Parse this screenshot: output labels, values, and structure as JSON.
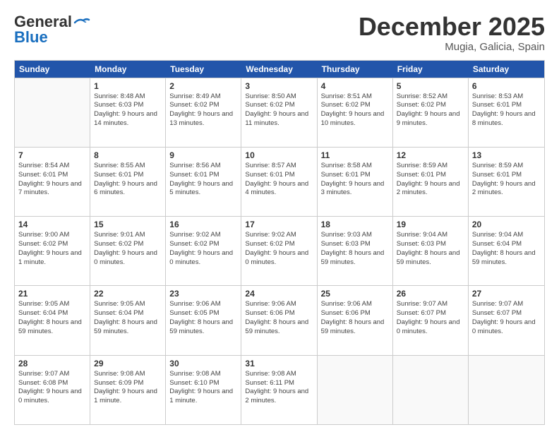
{
  "header": {
    "logo_general": "General",
    "logo_blue": "Blue",
    "month": "December 2025",
    "location": "Mugia, Galicia, Spain"
  },
  "days": [
    "Sunday",
    "Monday",
    "Tuesday",
    "Wednesday",
    "Thursday",
    "Friday",
    "Saturday"
  ],
  "weeks": [
    [
      {
        "date": "",
        "sunrise": "",
        "sunset": "",
        "daylight": ""
      },
      {
        "date": "1",
        "sunrise": "Sunrise: 8:48 AM",
        "sunset": "Sunset: 6:03 PM",
        "daylight": "Daylight: 9 hours and 14 minutes."
      },
      {
        "date": "2",
        "sunrise": "Sunrise: 8:49 AM",
        "sunset": "Sunset: 6:02 PM",
        "daylight": "Daylight: 9 hours and 13 minutes."
      },
      {
        "date": "3",
        "sunrise": "Sunrise: 8:50 AM",
        "sunset": "Sunset: 6:02 PM",
        "daylight": "Daylight: 9 hours and 11 minutes."
      },
      {
        "date": "4",
        "sunrise": "Sunrise: 8:51 AM",
        "sunset": "Sunset: 6:02 PM",
        "daylight": "Daylight: 9 hours and 10 minutes."
      },
      {
        "date": "5",
        "sunrise": "Sunrise: 8:52 AM",
        "sunset": "Sunset: 6:02 PM",
        "daylight": "Daylight: 9 hours and 9 minutes."
      },
      {
        "date": "6",
        "sunrise": "Sunrise: 8:53 AM",
        "sunset": "Sunset: 6:01 PM",
        "daylight": "Daylight: 9 hours and 8 minutes."
      }
    ],
    [
      {
        "date": "7",
        "sunrise": "Sunrise: 8:54 AM",
        "sunset": "Sunset: 6:01 PM",
        "daylight": "Daylight: 9 hours and 7 minutes."
      },
      {
        "date": "8",
        "sunrise": "Sunrise: 8:55 AM",
        "sunset": "Sunset: 6:01 PM",
        "daylight": "Daylight: 9 hours and 6 minutes."
      },
      {
        "date": "9",
        "sunrise": "Sunrise: 8:56 AM",
        "sunset": "Sunset: 6:01 PM",
        "daylight": "Daylight: 9 hours and 5 minutes."
      },
      {
        "date": "10",
        "sunrise": "Sunrise: 8:57 AM",
        "sunset": "Sunset: 6:01 PM",
        "daylight": "Daylight: 9 hours and 4 minutes."
      },
      {
        "date": "11",
        "sunrise": "Sunrise: 8:58 AM",
        "sunset": "Sunset: 6:01 PM",
        "daylight": "Daylight: 9 hours and 3 minutes."
      },
      {
        "date": "12",
        "sunrise": "Sunrise: 8:59 AM",
        "sunset": "Sunset: 6:01 PM",
        "daylight": "Daylight: 9 hours and 2 minutes."
      },
      {
        "date": "13",
        "sunrise": "Sunrise: 8:59 AM",
        "sunset": "Sunset: 6:01 PM",
        "daylight": "Daylight: 9 hours and 2 minutes."
      }
    ],
    [
      {
        "date": "14",
        "sunrise": "Sunrise: 9:00 AM",
        "sunset": "Sunset: 6:02 PM",
        "daylight": "Daylight: 9 hours and 1 minute."
      },
      {
        "date": "15",
        "sunrise": "Sunrise: 9:01 AM",
        "sunset": "Sunset: 6:02 PM",
        "daylight": "Daylight: 9 hours and 0 minutes."
      },
      {
        "date": "16",
        "sunrise": "Sunrise: 9:02 AM",
        "sunset": "Sunset: 6:02 PM",
        "daylight": "Daylight: 9 hours and 0 minutes."
      },
      {
        "date": "17",
        "sunrise": "Sunrise: 9:02 AM",
        "sunset": "Sunset: 6:02 PM",
        "daylight": "Daylight: 9 hours and 0 minutes."
      },
      {
        "date": "18",
        "sunrise": "Sunrise: 9:03 AM",
        "sunset": "Sunset: 6:03 PM",
        "daylight": "Daylight: 8 hours and 59 minutes."
      },
      {
        "date": "19",
        "sunrise": "Sunrise: 9:04 AM",
        "sunset": "Sunset: 6:03 PM",
        "daylight": "Daylight: 8 hours and 59 minutes."
      },
      {
        "date": "20",
        "sunrise": "Sunrise: 9:04 AM",
        "sunset": "Sunset: 6:04 PM",
        "daylight": "Daylight: 8 hours and 59 minutes."
      }
    ],
    [
      {
        "date": "21",
        "sunrise": "Sunrise: 9:05 AM",
        "sunset": "Sunset: 6:04 PM",
        "daylight": "Daylight: 8 hours and 59 minutes."
      },
      {
        "date": "22",
        "sunrise": "Sunrise: 9:05 AM",
        "sunset": "Sunset: 6:04 PM",
        "daylight": "Daylight: 8 hours and 59 minutes."
      },
      {
        "date": "23",
        "sunrise": "Sunrise: 9:06 AM",
        "sunset": "Sunset: 6:05 PM",
        "daylight": "Daylight: 8 hours and 59 minutes."
      },
      {
        "date": "24",
        "sunrise": "Sunrise: 9:06 AM",
        "sunset": "Sunset: 6:06 PM",
        "daylight": "Daylight: 8 hours and 59 minutes."
      },
      {
        "date": "25",
        "sunrise": "Sunrise: 9:06 AM",
        "sunset": "Sunset: 6:06 PM",
        "daylight": "Daylight: 8 hours and 59 minutes."
      },
      {
        "date": "26",
        "sunrise": "Sunrise: 9:07 AM",
        "sunset": "Sunset: 6:07 PM",
        "daylight": "Daylight: 9 hours and 0 minutes."
      },
      {
        "date": "27",
        "sunrise": "Sunrise: 9:07 AM",
        "sunset": "Sunset: 6:07 PM",
        "daylight": "Daylight: 9 hours and 0 minutes."
      }
    ],
    [
      {
        "date": "28",
        "sunrise": "Sunrise: 9:07 AM",
        "sunset": "Sunset: 6:08 PM",
        "daylight": "Daylight: 9 hours and 0 minutes."
      },
      {
        "date": "29",
        "sunrise": "Sunrise: 9:08 AM",
        "sunset": "Sunset: 6:09 PM",
        "daylight": "Daylight: 9 hours and 1 minute."
      },
      {
        "date": "30",
        "sunrise": "Sunrise: 9:08 AM",
        "sunset": "Sunset: 6:10 PM",
        "daylight": "Daylight: 9 hours and 1 minute."
      },
      {
        "date": "31",
        "sunrise": "Sunrise: 9:08 AM",
        "sunset": "Sunset: 6:11 PM",
        "daylight": "Daylight: 9 hours and 2 minutes."
      },
      {
        "date": "",
        "sunrise": "",
        "sunset": "",
        "daylight": ""
      },
      {
        "date": "",
        "sunrise": "",
        "sunset": "",
        "daylight": ""
      },
      {
        "date": "",
        "sunrise": "",
        "sunset": "",
        "daylight": ""
      }
    ]
  ]
}
